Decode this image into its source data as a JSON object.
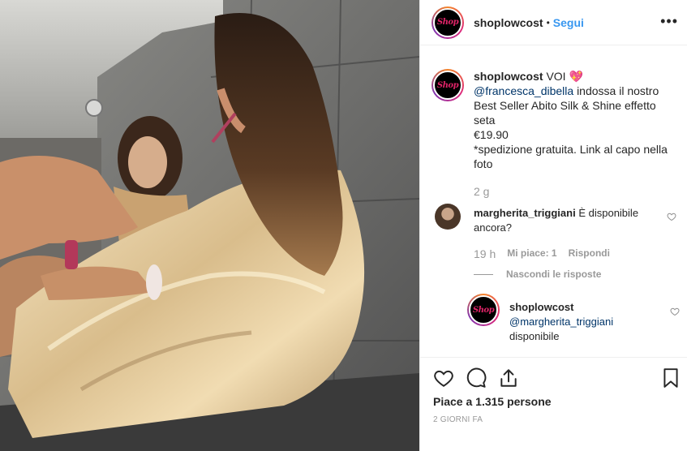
{
  "header": {
    "username": "shoplowcost",
    "separator": "•",
    "follow_label": "Segui",
    "more_label": "•••",
    "avatar_text": "Shop"
  },
  "caption": {
    "username": "shoplowcost",
    "title_text": "VOI",
    "emoji": "💖",
    "mention": "@francesca_dibella",
    "line1": "indossa il nostro Best Seller Abito Silk & Shine effetto seta",
    "price": "€19.90",
    "line2": "*spedizione gratuita. Link al capo nella foto",
    "time": "2 g"
  },
  "comment": {
    "username": "margherita_triggiani",
    "text": "È disponibile ancora?",
    "time": "19 h",
    "likes": "Mi piace: 1",
    "reply_label": "Rispondi",
    "hide_replies_label": "Nascondi le risposte"
  },
  "reply": {
    "username": "shoplowcost",
    "mention": "@margherita_triggiani",
    "text": "disponibile"
  },
  "actions": {
    "likes_text": "Piace a 1.315 persone",
    "date": "2 GIORNI FA",
    "icons": [
      "heart-icon",
      "comment-icon",
      "share-icon",
      "bookmark-icon"
    ]
  },
  "colors": {
    "accent": "#3897f0",
    "mention": "#003569",
    "muted": "#999999",
    "text": "#262626"
  }
}
